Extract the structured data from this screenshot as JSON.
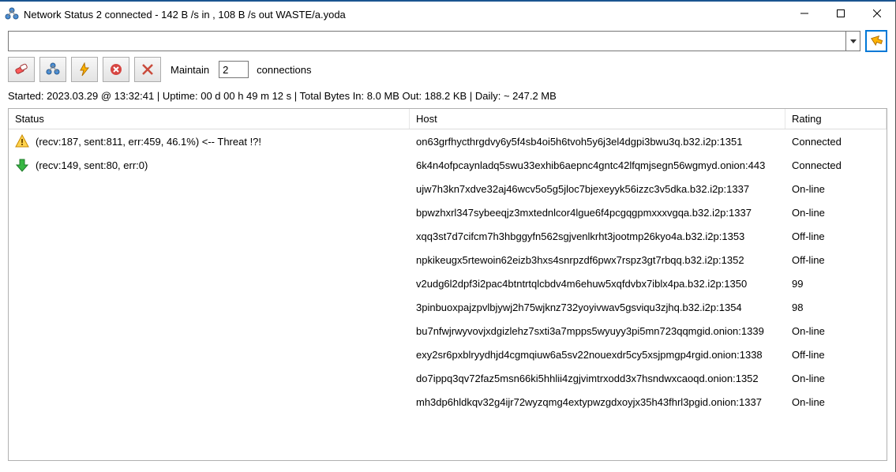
{
  "window": {
    "title": "Network Status 2 connected -  142 B /s in , 108 B /s out WASTE/a.yoda"
  },
  "address_bar": {
    "value": ""
  },
  "toolbar": {
    "maintain_label": "Maintain",
    "maintain_value": "2",
    "connections_label": "connections"
  },
  "info_line": "Started: 2023.03.29 @ 13:32:41 | Uptime: 00 d 00 h 49 m 12 s | Total Bytes  In: 8.0 MB  Out: 188.2 KB  | Daily: ~ 247.2 MB",
  "columns": {
    "status": "Status",
    "host": "Host",
    "rating": "Rating"
  },
  "rows": [
    {
      "icon": "warning",
      "status": "(recv:187, sent:811, err:459, 46.1%) <-- Threat !?!",
      "host": "on63grfhycthrgdvy6y5f4sb4oi5h6tvoh5y6j3el4dgpi3bwu3q.b32.i2p:1351",
      "rating": "Connected"
    },
    {
      "icon": "down",
      "status": "(recv:149, sent:80, err:0)",
      "host": "6k4n4ofpcaynladq5swu33exhib6aepnc4gntc42lfqmjsegn56wgmyd.onion:443",
      "rating": "Connected"
    },
    {
      "icon": "",
      "status": "",
      "host": "ujw7h3kn7xdve32aj46wcv5o5g5jloc7bjexeyyk56izzc3v5dka.b32.i2p:1337",
      "rating": "On-line"
    },
    {
      "icon": "",
      "status": "",
      "host": "bpwzhxrl347sybeeqjz3mxtednlcor4lgue6f4pcgqgpmxxxvgqa.b32.i2p:1337",
      "rating": "On-line"
    },
    {
      "icon": "",
      "status": "",
      "host": "xqq3st7d7cifcm7h3hbggyfn562sgjvenlkrht3jootmp26kyo4a.b32.i2p:1353",
      "rating": "Off-line"
    },
    {
      "icon": "",
      "status": "",
      "host": "npkikeugx5rtewoin62eizb3hxs4snrpzdf6pwx7rspz3gt7rbqq.b32.i2p:1352",
      "rating": "Off-line"
    },
    {
      "icon": "",
      "status": "",
      "host": "v2udg6l2dpf3i2pac4btntrtqlcbdv4m6ehuw5xqfdvbx7iblx4pa.b32.i2p:1350",
      "rating": "99"
    },
    {
      "icon": "",
      "status": "",
      "host": "3pinbuoxpajzpvlbjywj2h75wjknz732yoyivwav5gsviqu3zjhq.b32.i2p:1354",
      "rating": "98"
    },
    {
      "icon": "",
      "status": "",
      "host": "bu7nfwjrwyvovjxdgizlehz7sxti3a7mpps5wyuyy3pi5mn723qqmgid.onion:1339",
      "rating": "On-line"
    },
    {
      "icon": "",
      "status": "",
      "host": "exy2sr6pxblryydhjd4cgmqiuw6a5sv22nouexdr5cy5xsjpmgp4rgid.onion:1338",
      "rating": "Off-line"
    },
    {
      "icon": "",
      "status": "",
      "host": "do7ippq3qv72faz5msn66ki5hhlii4zgjvimtrxodd3x7hsndwxcaoqd.onion:1352",
      "rating": "On-line"
    },
    {
      "icon": "",
      "status": "",
      "host": "mh3dp6hldkqv32g4ijr72wyzqmg4extypwzgdxoyjx35h43fhrl3pgid.onion:1337",
      "rating": "On-line"
    }
  ]
}
